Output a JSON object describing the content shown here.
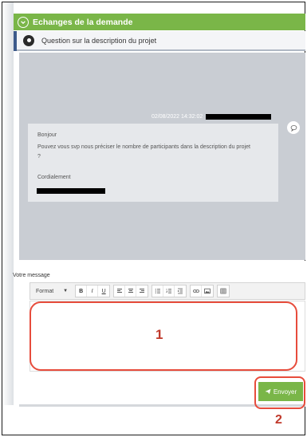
{
  "section": {
    "title": "Echanges de la demande"
  },
  "thread": {
    "title": "Question sur la description du projet"
  },
  "message": {
    "datetime": "02/08/2022 14:32:02",
    "greeting": "Bonjour",
    "body_line1": "Pouvez vous svp nous préciser le nombre de participants dans la description du projet",
    "body_line2": "?",
    "closing": "Cordialement"
  },
  "composer": {
    "label": "Votre message",
    "format_label": "Format",
    "format_arrow": "▼",
    "tools": [
      "B",
      "I",
      "U"
    ]
  },
  "send": {
    "label": "Envoyer"
  },
  "annotations": {
    "editor_number": "1",
    "send_number": "2"
  },
  "colors": {
    "accent_green": "#7ab648",
    "annotation_red": "#e74c3c",
    "chat_bg": "#c9cdd3"
  }
}
